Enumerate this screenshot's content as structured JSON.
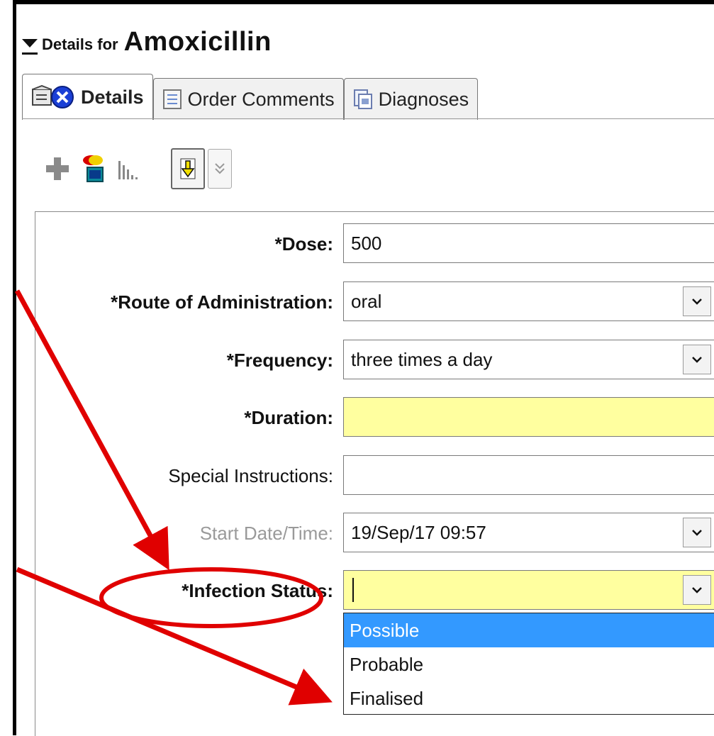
{
  "header": {
    "prefix": "Details for",
    "drug_name": "Amoxicillin"
  },
  "tabs": [
    {
      "label": "Details",
      "active": true
    },
    {
      "label": "Order Comments",
      "active": false
    },
    {
      "label": "Diagnoses",
      "active": false
    }
  ],
  "toolbar": {
    "icons": [
      "add-icon",
      "order-toggle-icon",
      "chart-icon",
      "arrow-down-icon",
      "double-chevron-down-icon"
    ]
  },
  "form": {
    "dose": {
      "label": "*Dose:",
      "value": "500"
    },
    "route": {
      "label": "*Route of Administration:",
      "value": "oral"
    },
    "frequency": {
      "label": "*Frequency:",
      "value": "three times a day"
    },
    "duration": {
      "label": "*Duration:",
      "value": ""
    },
    "special": {
      "label": "Special Instructions:",
      "value": ""
    },
    "start": {
      "label": "Start Date/Time:",
      "value": "19/Sep/17 09:57"
    },
    "infection": {
      "label": "*Infection Status:",
      "value": ""
    }
  },
  "dropdown": {
    "options": [
      "Possible",
      "Probable",
      "Finalised"
    ],
    "highlighted": "Possible"
  },
  "colors": {
    "required_field": "#ffff9f",
    "selection": "#3399ff",
    "annotation": "#e00000"
  }
}
